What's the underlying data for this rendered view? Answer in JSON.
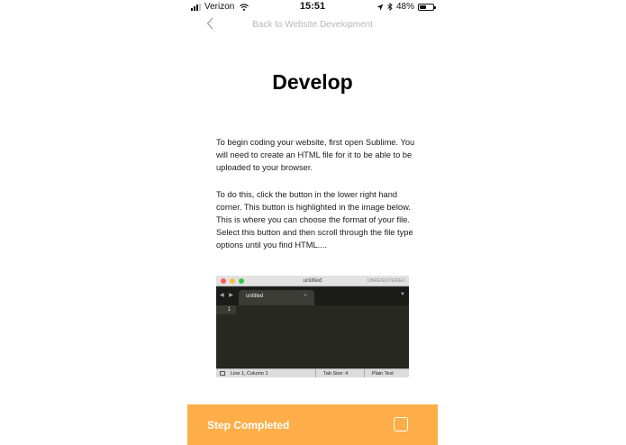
{
  "status_bar": {
    "carrier": "Verizon",
    "time": "15:51",
    "battery_percent": "48%",
    "battery_level": 0.48,
    "signal_bars_filled": 3,
    "signal_bars_total": 4,
    "icons": [
      "signal-icon",
      "wifi-icon",
      "location-icon",
      "bluetooth-icon",
      "battery-icon"
    ]
  },
  "nav": {
    "back_icon": "chevron-left-icon",
    "title": "Back to Website Development"
  },
  "page": {
    "title": "Develop",
    "paragraph_1": "To begin coding your website, first open Sublime. You will need to create an HTML file for it to be able to be uploaded to your browser.",
    "paragraph_2": "To do this, click the button in the lower right hand corner. This button is highlighted in the image below. This is where you can choose the format of your file. Select this button and then scroll through the file type options until you find HTML...."
  },
  "sublime_screenshot": {
    "window_title": "untitled",
    "license_label": "UNREGISTERED",
    "tab_nav_arrows": "◀ ▶",
    "tab_name": "untitled",
    "tab_close": "×",
    "tab_dropdown": "▼",
    "line_number": "1",
    "status_position": "Line 1, Column 1",
    "status_tab_size": "Tab Size: 4",
    "status_syntax": "Plain Text",
    "colors": {
      "editor_bg": "#272822",
      "close": "#fc605b",
      "minimize": "#fdbc40",
      "zoom": "#34c84a"
    }
  },
  "cta": {
    "label": "Step Completed",
    "checked": false,
    "color": "#fdae48"
  }
}
